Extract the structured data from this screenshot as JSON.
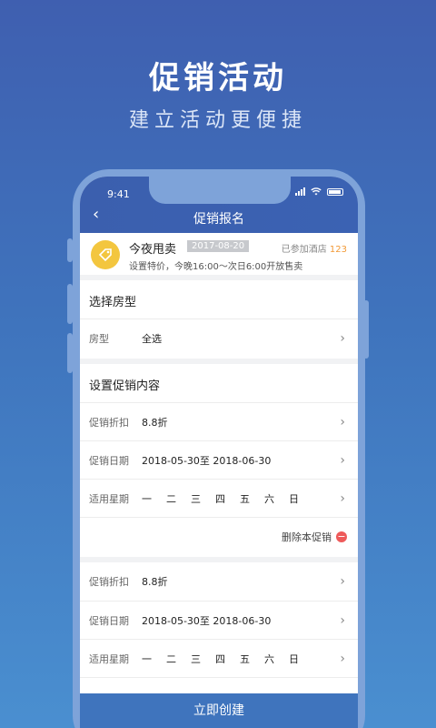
{
  "hero": {
    "title": "促销活动",
    "subtitle": "建立活动更便捷"
  },
  "status": {
    "time": "9:41"
  },
  "nav": {
    "back": "‹",
    "title": "促销报名"
  },
  "promo": {
    "name": "今夜甩卖",
    "date": "2017-08-20",
    "joined_label": "已参加酒店",
    "joined_count": "123",
    "desc": "设置特价，今晚16:00～次日6:00开放售卖"
  },
  "room": {
    "section_title": "选择房型",
    "label": "房型",
    "value": "全选"
  },
  "promo_content": {
    "section_title": "设置促销内容"
  },
  "promo1": {
    "discount_label": "促销折扣",
    "discount_value": "8.8折",
    "date_label": "促销日期",
    "date_value": "2018-05-30至 2018-06-30",
    "weekday_label": "适用星期",
    "days": [
      "一",
      "二",
      "三",
      "四",
      "五",
      "六",
      "日"
    ],
    "delete_label": "删除本促销"
  },
  "promo2": {
    "discount_label": "促销折扣",
    "discount_value": "8.8折",
    "date_label": "促销日期",
    "date_value": "2018-05-30至 2018-06-30",
    "weekday_label": "适用星期",
    "days": [
      "一",
      "二",
      "三",
      "四",
      "五",
      "六",
      "日"
    ]
  },
  "chevron": "›",
  "create_button": "立即创建",
  "colors": {
    "brand": "#3f74bd",
    "accent": "#f29a38",
    "delete": "#ee5a5a",
    "icon_yellow": "#f3c63f"
  }
}
